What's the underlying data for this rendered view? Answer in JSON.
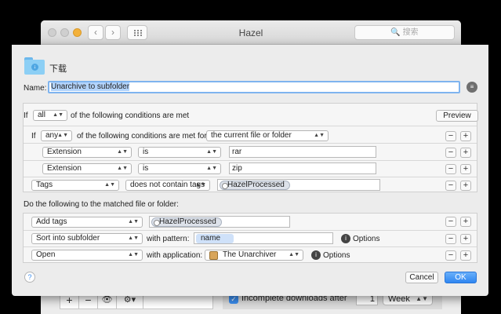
{
  "app": {
    "title": "Hazel",
    "search_placeholder": "🔍 搜索",
    "nav_back": "‹",
    "nav_forward": "›",
    "bottom_add": "+",
    "bottom_remove": "−",
    "bottom_eye": "👁",
    "bottom_gear": "⚙▾",
    "incomplete_checked": "✓",
    "incomplete_label": "Incomplete downloads after",
    "incomplete_value": "1",
    "incomplete_unit": "Week"
  },
  "sheet": {
    "folder_name": "下载",
    "name_label": "Name:",
    "name_value": "Unarchive to subfolder",
    "info_icon": "≡",
    "conditions": {
      "if_label": "If",
      "match": "all",
      "match_suffix": "of the following conditions are met",
      "preview": "Preview",
      "nested": {
        "if_label": "If",
        "match": "any",
        "match_suffix": "of the following conditions are met for",
        "target": "the current file or folder",
        "rows": [
          {
            "attribute": "Extension",
            "operator": "is",
            "value": "rar"
          },
          {
            "attribute": "Extension",
            "operator": "is",
            "value": "zip"
          }
        ]
      },
      "tags_row": {
        "attribute": "Tags",
        "operator": "does not contain tags",
        "value": "HazelProcessed"
      }
    },
    "actions_heading": "Do the following to the matched file or folder:",
    "actions": [
      {
        "action": "Add tags",
        "value": "HazelProcessed"
      },
      {
        "action": "Sort into subfolder",
        "with_label": "with pattern:",
        "token": "name",
        "options": "Options"
      },
      {
        "action": "Open",
        "with_label": "with application:",
        "app": "The Unarchiver",
        "options": "Options"
      }
    ],
    "help": "?",
    "cancel": "Cancel",
    "ok": "OK",
    "minus": "−",
    "plus": "+"
  }
}
